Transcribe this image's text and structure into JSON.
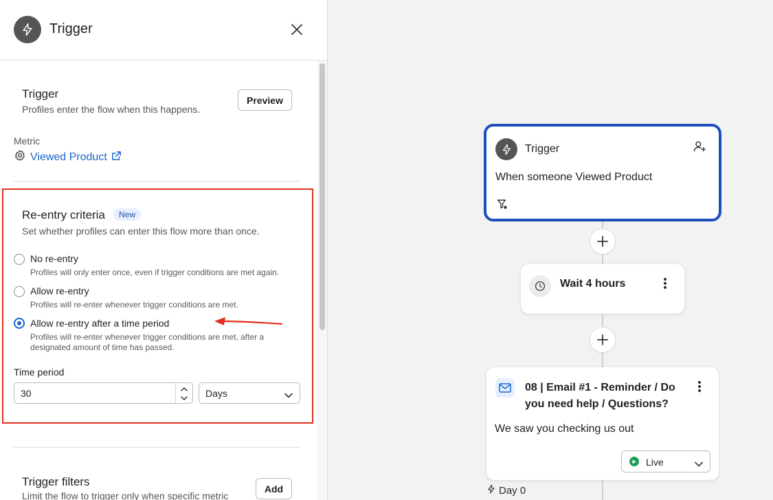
{
  "panel": {
    "title": "Trigger"
  },
  "trigger_section": {
    "title": "Trigger",
    "subtitle": "Profiles enter the flow when this happens.",
    "preview_label": "Preview",
    "metric_label": "Metric",
    "metric_value": "Viewed Product"
  },
  "reentry": {
    "title": "Re-entry criteria",
    "badge": "New",
    "subtitle": "Set whether profiles can enter this flow more than once.",
    "options": [
      {
        "label": "No re-entry",
        "desc": "Profiles will only enter once, even if trigger conditions are met again.",
        "checked": false
      },
      {
        "label": "Allow re-entry",
        "desc": "Profiles will re-enter whenever trigger conditions are met.",
        "checked": false
      },
      {
        "label": "Allow re-entry after a time period",
        "desc": "Profiles will re-enter whenever trigger conditions are met, after a designated amount of time has passed.",
        "checked": true
      }
    ],
    "time_period_label": "Time period",
    "time_value": "30",
    "time_unit": "Days"
  },
  "filters": {
    "title": "Trigger filters",
    "subtitle": "Limit the flow to trigger only when specific metric",
    "add_label": "Add"
  },
  "canvas": {
    "trigger_card": {
      "title": "Trigger",
      "desc": "When someone Viewed Product"
    },
    "wait_card": {
      "title": "Wait 4 hours"
    },
    "email_card": {
      "title": "08 | Email #1 - Reminder / Do you need help / Questions?",
      "desc": "We saw you checking us out",
      "status": "Live"
    },
    "day_label": "Day 0"
  },
  "colors": {
    "accent": "#1866c9",
    "highlight_border": "#e0301e",
    "selected_card": "#1b4fbf",
    "live": "#1e9e57"
  }
}
